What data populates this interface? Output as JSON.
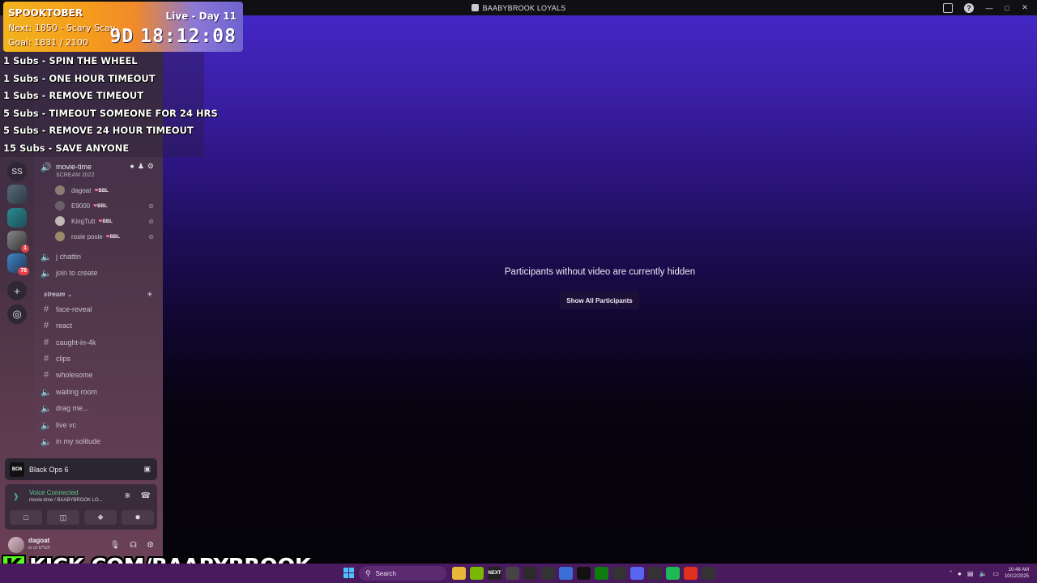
{
  "window": {
    "title": "BAABYBROOK LOYALS"
  },
  "window_controls": {
    "minimize": "—",
    "maximize": "□",
    "close": "✕"
  },
  "titlebar_icons": {
    "inbox": "inbox-icon",
    "help": "?"
  },
  "overlay_goal": {
    "title": "SPOOKTOBER",
    "next": "Next: 1850 - Scary Scav",
    "goal": "Goal: 1831 / 2100",
    "live_day": "Live - Day 11",
    "days": "9D",
    "timer": "18:12:08"
  },
  "overlay_rewards": [
    "1 Subs - SPIN THE WHEEL",
    "1 Subs - ONE HOUR TIMEOUT",
    "1 Subs - REMOVE TIMEOUT",
    "5 Subs - TIMEOUT SOMEONE FOR 24 HRS",
    "5 Subs - REMOVE 24 HOUR TIMEOUT",
    "15 Subs - SAVE ANYONE"
  ],
  "servers": [
    {
      "label": "SS",
      "badge": ""
    },
    {
      "label": "",
      "badge": ""
    },
    {
      "label": "",
      "badge": ""
    },
    {
      "label": "",
      "badge": "1"
    },
    {
      "label": "",
      "badge": "78"
    }
  ],
  "server_actions": {
    "add": "+",
    "discover": "◎"
  },
  "active_voice_channel": {
    "name": "movie-time",
    "status": "SCREAM 2022"
  },
  "members": [
    {
      "name": "dagoat",
      "tag": "BBL",
      "muted": false
    },
    {
      "name": "E9000",
      "tag": "BBL",
      "muted": true
    },
    {
      "name": "KingTutt",
      "tag": "BBL",
      "muted": true
    },
    {
      "name": "rosie posie",
      "tag": "BBL",
      "muted": true
    }
  ],
  "voice_channels_top": [
    "j chattin",
    "join to create"
  ],
  "category": {
    "name": "stream",
    "add": "+"
  },
  "text_channels": [
    "face-reveal",
    "react",
    "caught-in-4k",
    "clips",
    "wholesome"
  ],
  "voice_channels_bottom": [
    "waiting room",
    "drag me...",
    "live vc",
    "in my solitude"
  ],
  "activity": {
    "game": "Black Ops 6",
    "game_icon": "BO6"
  },
  "voice_panel": {
    "title": "Voice Connected",
    "subtitle": "movie-time / BAABYBROOK LO..."
  },
  "user": {
    "name": "dagoat",
    "status": "w ur b*tch"
  },
  "stage": {
    "message": "Participants without video are currently hidden",
    "button": "Show All Participants"
  },
  "kick": {
    "logo": "K",
    "url": "KICK.COM/BAABYBROOK"
  },
  "taskbar": {
    "search": "Search",
    "apps": [
      "",
      "",
      "NEXT",
      "",
      "",
      "",
      "",
      "",
      "",
      "",
      "",
      "",
      "",
      "",
      ""
    ],
    "time": "10:48 AM",
    "date": "10/12/2025"
  },
  "colors": {
    "accent": "#4327c4",
    "voice_green": "#43b581",
    "kick_green": "#53fc18",
    "taskbar": "#4a1a5e"
  }
}
